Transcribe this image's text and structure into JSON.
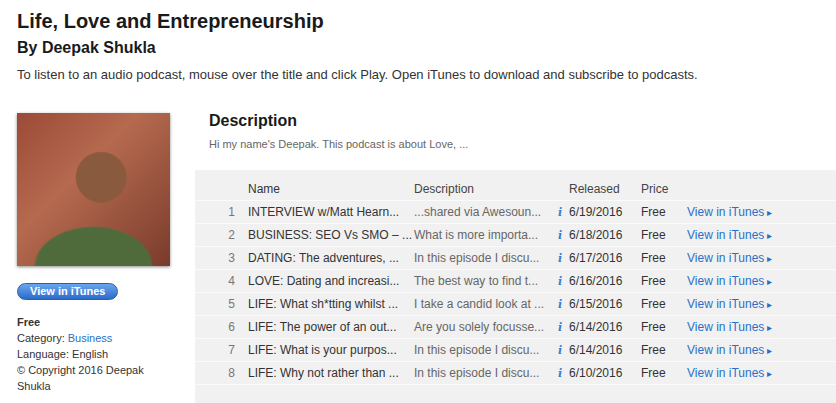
{
  "header": {
    "title": "Life, Love and Entrepreneurship",
    "author": "By Deepak Shukla",
    "instructions": "To listen to an audio podcast, mouse over the title and click Play. Open iTunes to download and subscribe to podcasts."
  },
  "sidebar": {
    "button": "View in iTunes",
    "price": "Free",
    "category_label": "Category:",
    "category": "Business",
    "language": "Language: English",
    "copyright": "© Copyright 2016 Deepak Shukla"
  },
  "description": {
    "heading": "Description",
    "text": "Hi my name's Deepak. This podcast is about Love, ..."
  },
  "table": {
    "columns": [
      "Name",
      "Description",
      "Released",
      "Price"
    ],
    "rows": [
      {
        "number": "1",
        "name": "INTERVIEW w/Matt Hearn...",
        "description": "...shared via Awesoun...",
        "info": "i",
        "released": "6/19/2016",
        "price": "Free",
        "link": "View in iTunes",
        "arrow": "▸"
      },
      {
        "number": "2",
        "name": "BUSINESS: SEO Vs SMO – ...",
        "description": "What is more importa...",
        "info": "i",
        "released": "6/18/2016",
        "price": "Free",
        "link": "View in iTunes",
        "arrow": "▸"
      },
      {
        "number": "3",
        "name": "DATING: The adventures, ...",
        "description": "In this episode I discu...",
        "info": "i",
        "released": "6/17/2016",
        "price": "Free",
        "link": "View in iTunes",
        "arrow": "▸"
      },
      {
        "number": "4",
        "name": "LOVE: Dating and increasi...",
        "description": "The best way to find t...",
        "info": "i",
        "released": "6/16/2016",
        "price": "Free",
        "link": "View in iTunes",
        "arrow": "▸"
      },
      {
        "number": "5",
        "name": "LIFE: What sh*tting whilst ...",
        "description": "I take a candid look at ...",
        "info": "i",
        "released": "6/15/2016",
        "price": "Free",
        "link": "View in iTunes",
        "arrow": "▸"
      },
      {
        "number": "6",
        "name": "LIFE: The power of an out...",
        "description": "Are you solely focusse...",
        "info": "i",
        "released": "6/14/2016",
        "price": "Free",
        "link": "View in iTunes",
        "arrow": "▸"
      },
      {
        "number": "7",
        "name": "LIFE: What is your purpos...",
        "description": "In this episode I discu...",
        "info": "i",
        "released": "6/14/2016",
        "price": "Free",
        "link": "View in iTunes",
        "arrow": "▸"
      },
      {
        "number": "8",
        "name": "LIFE: Why not rather than ...",
        "description": "In this episode I discu...",
        "info": "i",
        "released": "6/10/2016",
        "price": "Free",
        "link": "View in iTunes",
        "arrow": "▸"
      }
    ]
  }
}
